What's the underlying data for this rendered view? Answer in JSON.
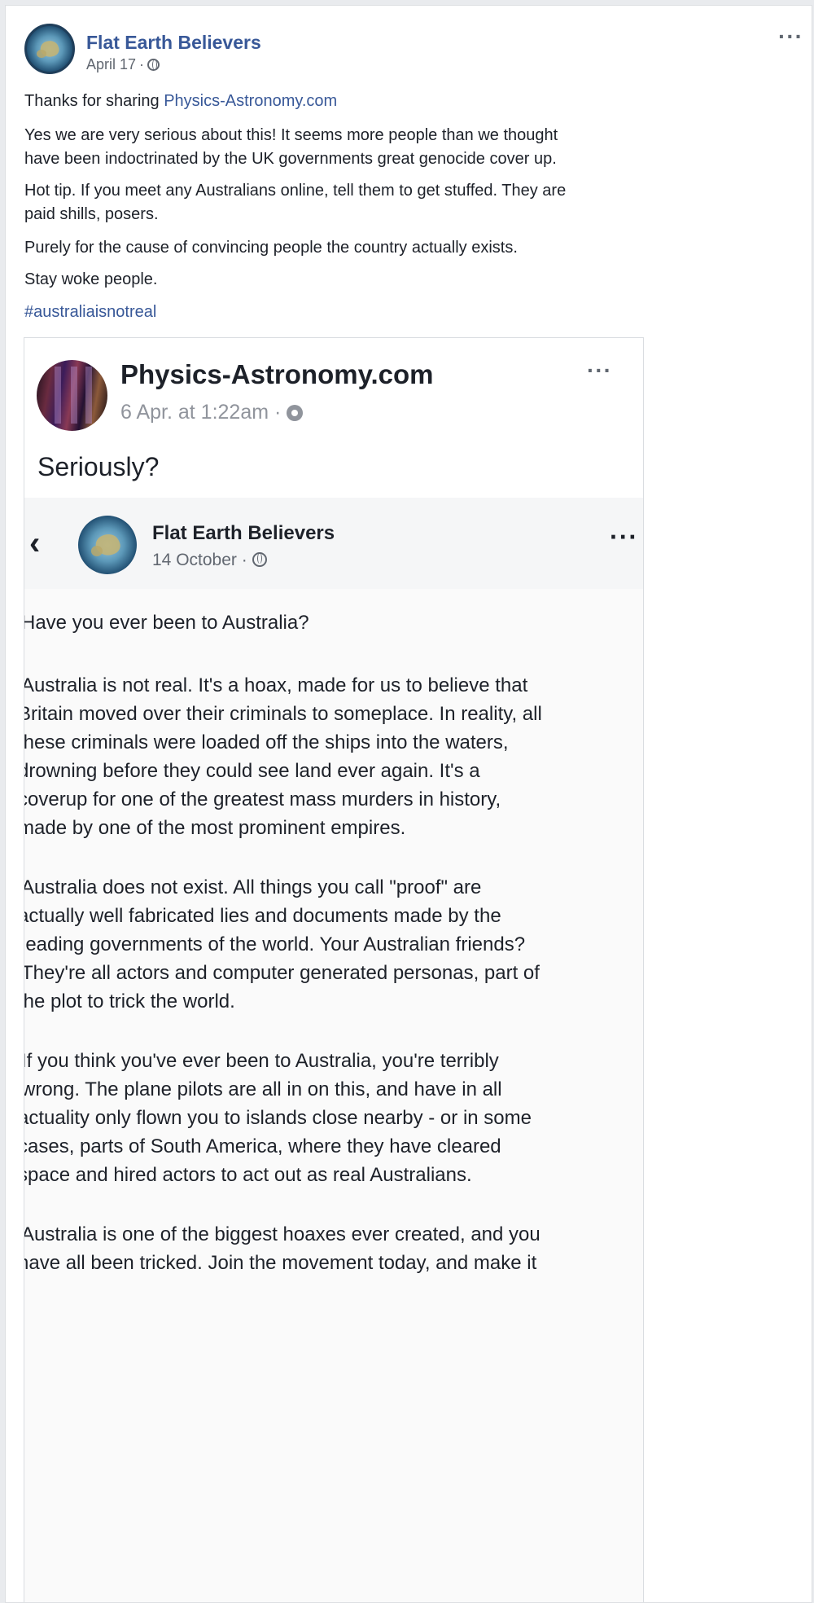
{
  "post": {
    "page_name": "Flat Earth Believers",
    "date": "April 17",
    "date_sep": "·",
    "more": "···",
    "thanks_prefix": "Thanks for sharing ",
    "thanks_link": "Physics-Astronomy.com",
    "paragraphs": [
      "Yes we are very serious about this! It seems more people than we thought",
      "have been indoctrinated by the UK governments great genocide cover up.",
      "Hot tip. If you meet any Australians online, tell them to get stuffed. They are",
      "paid shills, posers.",
      "Purely for the cause of convincing people the country actually exists.",
      "Stay woke people."
    ],
    "hashtag": "#australiaisnotreal"
  },
  "shared": {
    "page_name": "Physics-Astronomy.com",
    "date": "6 Apr. at 1:22am",
    "date_sep": "·",
    "more": "···",
    "text": "Seriously?",
    "screenshot": {
      "back": "‹",
      "page_name": "Flat Earth Believers",
      "date": "14 October",
      "date_sep": "·",
      "more": "···",
      "lines": [
        "Have you ever been to Australia?",
        "Australia is not real. It's a hoax, made for us to believe that",
        "Britain moved over their criminals to someplace. In reality, all",
        "these criminals were loaded off the ships into the waters,",
        "drowning before they could see land ever again. It's a",
        "coverup for one of the greatest mass murders in history,",
        "made by one of the most prominent empires.",
        "Australia does not exist. All things you call \"proof\" are",
        "actually well fabricated lies and documents made by the",
        "leading governments of the world. Your Australian friends?",
        "They're all actors and computer generated personas, part of",
        "the plot to trick the world.",
        "If you think you've ever been to Australia, you're terribly",
        "wrong. The plane pilots are all in on this, and have in all",
        "actuality only flown you to islands close nearby - or in some",
        "cases, parts of South America, where they have cleared",
        "space and hired actors to act out as real Australians.",
        "Australia is one of the biggest hoaxes ever created, and you",
        "have all been tricked. Join the movement today, and make it"
      ]
    }
  },
  "colors": {
    "link": "#385898",
    "text": "#1d2129",
    "meta": "#616770",
    "border": "#dadde1"
  },
  "icons": [
    "globe-icon",
    "gear-icon",
    "more-icon",
    "back-arrow-icon"
  ]
}
